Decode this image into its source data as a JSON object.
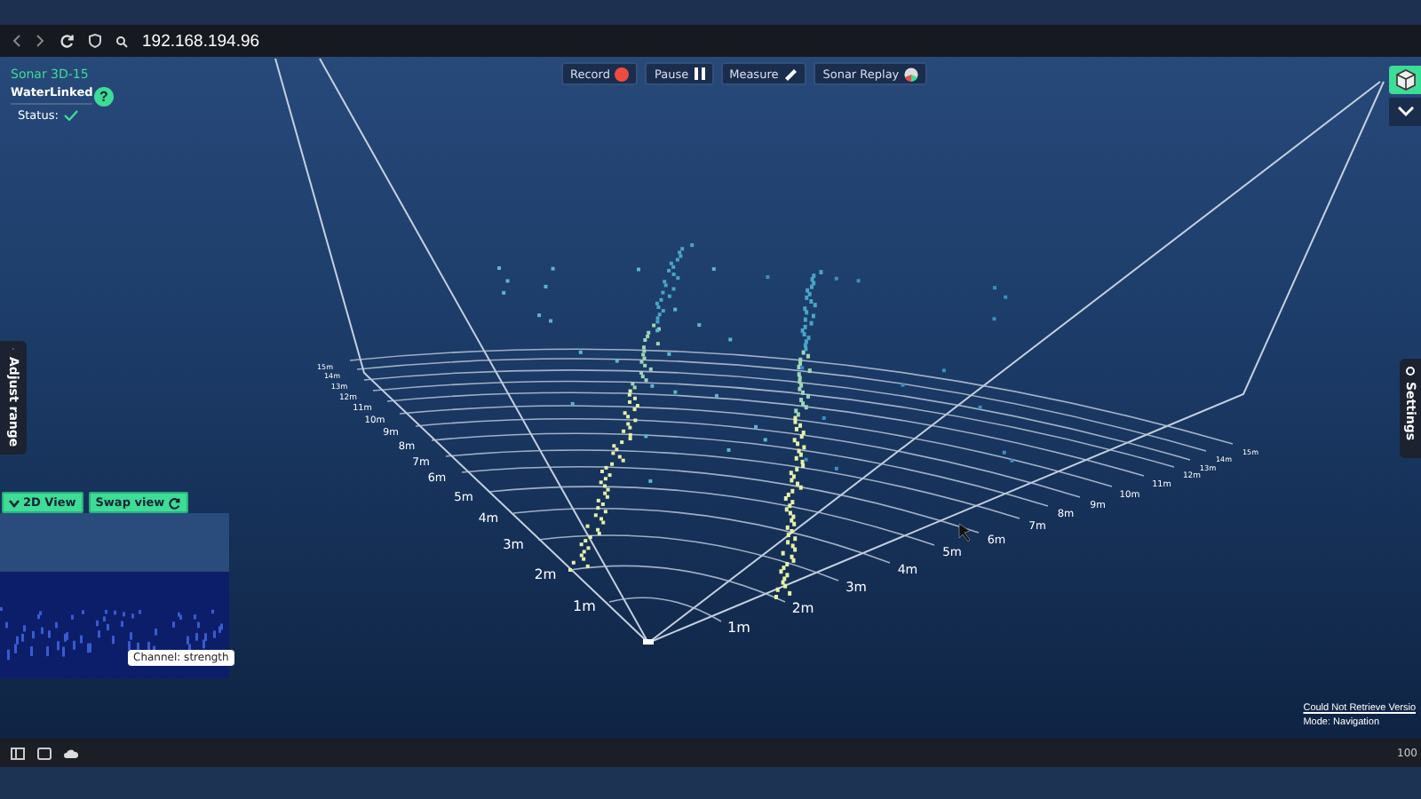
{
  "browser": {
    "url": "192.168.194.96"
  },
  "device": {
    "model": "Sonar 3D-15",
    "brand": "WaterLinked",
    "status_label": "Status:",
    "status_ok": true
  },
  "help": {
    "label": "?"
  },
  "toolbar": [
    {
      "kind": "record",
      "label": "Record"
    },
    {
      "kind": "pause",
      "label": "Pause"
    },
    {
      "kind": "measure",
      "label": "Measure"
    },
    {
      "kind": "replay",
      "label": "Sonar Replay"
    }
  ],
  "side_tabs": {
    "left": "Adjust range",
    "right": "Settings"
  },
  "view_buttons": [
    {
      "kind": "view",
      "label": "2D View"
    },
    {
      "kind": "swap",
      "label": "Swap view"
    }
  ],
  "preview": {
    "channel_label": "Channel: strength"
  },
  "range_labels_left": [
    "1m",
    "2m",
    "3m",
    "4m",
    "5m",
    "6m",
    "7m",
    "8m",
    "9m",
    "10m",
    "11m",
    "12m",
    "13m",
    "14m",
    "15m"
  ],
  "range_labels_right": [
    "1m",
    "2m",
    "3m",
    "4m",
    "5m",
    "6m",
    "7m",
    "8m",
    "9m",
    "10m",
    "11m",
    "12m",
    "13m",
    "14m",
    "15m"
  ],
  "info": {
    "version_link": "Could Not Retrieve Versio",
    "mode": "Mode: Navigation"
  },
  "status_bar": {
    "zoom": "100"
  }
}
